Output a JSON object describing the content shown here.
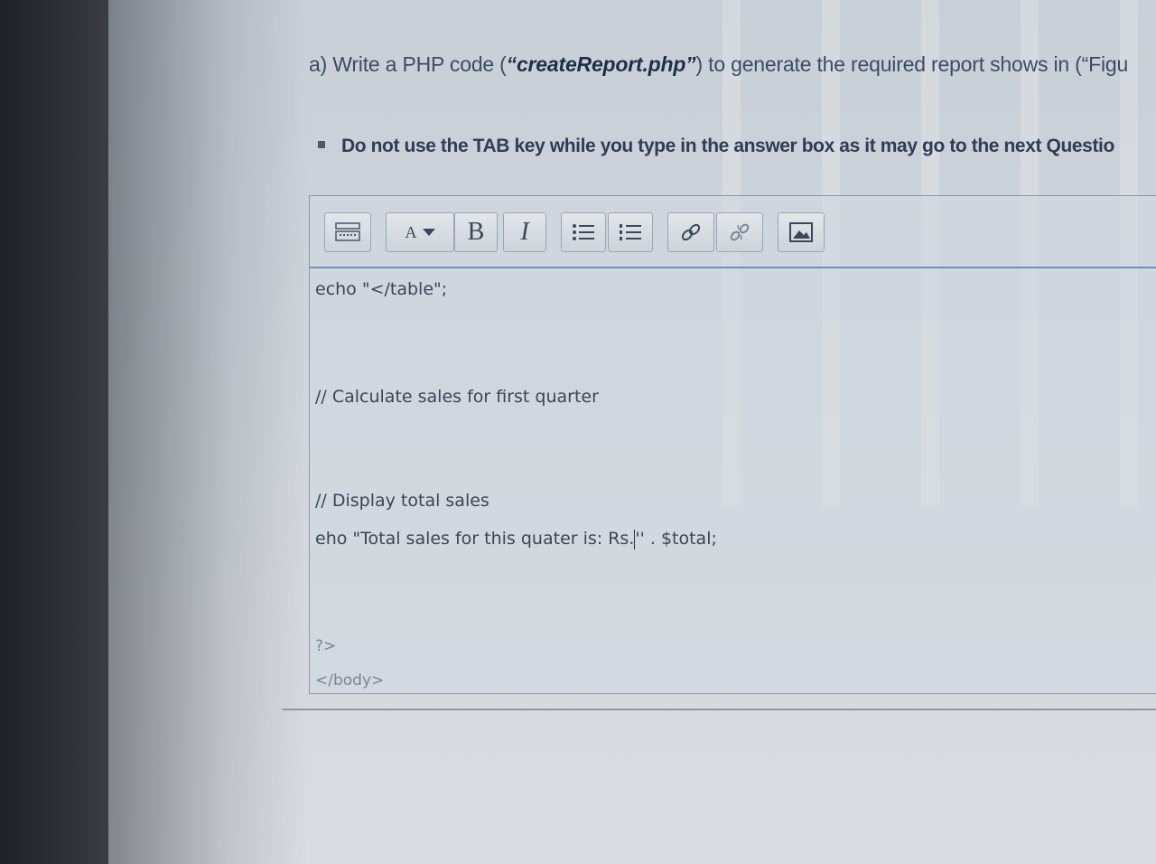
{
  "question": {
    "prefix": "a)  Write a PHP code (",
    "filename": "“createReport.php”",
    "suffix": ") to generate the required report shows in (“Figu"
  },
  "note": {
    "text": "Do not use the TAB key while you type in the answer box as it may go to the next Questio"
  },
  "toolbar": {
    "font_size_label": "A",
    "bold_label": "B",
    "italic_label": "I"
  },
  "editor": {
    "lines": [
      "echo \"</table\";",
      "// Calculate sales for first quarter",
      "// Display total sales",
      "eho \"Total sales for this quater is: Rs.",
      "'' . $total;",
      "?>",
      "</body>"
    ]
  }
}
